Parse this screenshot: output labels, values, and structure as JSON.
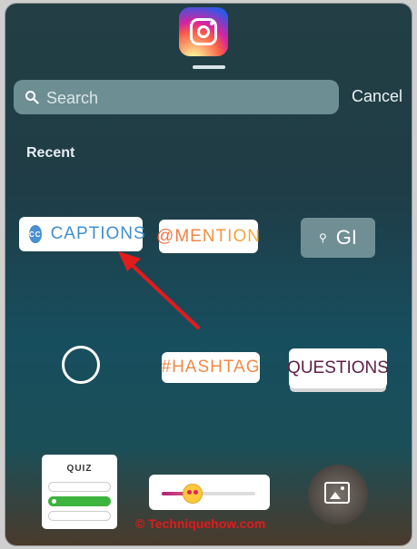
{
  "search": {
    "placeholder": "Search"
  },
  "header": {
    "cancel_label": "Cancel"
  },
  "sections": {
    "recent_label": "Recent"
  },
  "stickers": {
    "captions": {
      "icon_text": "CC",
      "label": "CAPTIONS"
    },
    "mention": {
      "label": "@MENTION"
    },
    "gif": {
      "label": "GI"
    },
    "hashtag": {
      "label": "#HASHTAG"
    },
    "questions": {
      "label": "QUESTIONS"
    },
    "quiz": {
      "label": "QUIZ"
    },
    "slider": {
      "level": 0.33
    }
  },
  "icons": {
    "logo": "instagram-logo",
    "search": "search-icon",
    "camera_circle": "circle-icon",
    "photo": "image-icon"
  },
  "watermark": {
    "text": "© Techniquehow.com"
  },
  "colors": {
    "annotation_arrow": "#e21b1b",
    "captions_text": "#3f8fd1"
  }
}
